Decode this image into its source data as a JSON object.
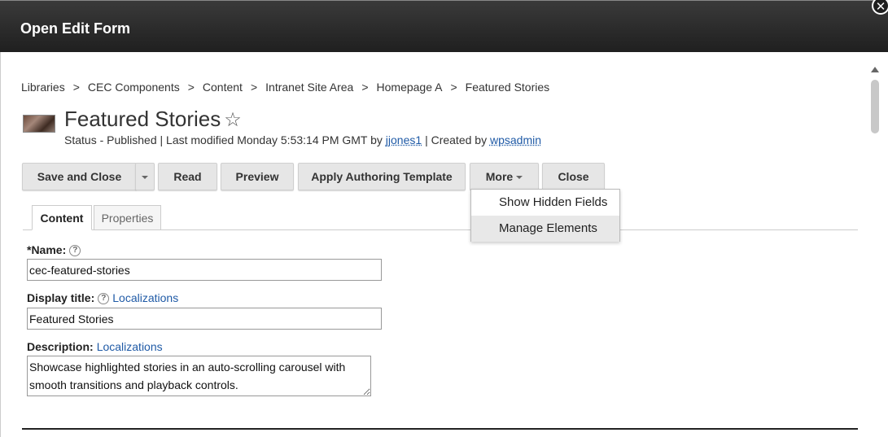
{
  "dialog": {
    "title": "Open Edit Form",
    "close_glyph": "✕"
  },
  "breadcrumb": [
    "Libraries",
    "CEC Components",
    "Content",
    "Intranet Site Area",
    "Homepage A",
    "Featured Stories"
  ],
  "breadcrumb_separator": ">",
  "item": {
    "title": "Featured Stories",
    "favorite_glyph": "☆",
    "status_prefix": "Status - Published | Last modified Monday 5:53:14 PM GMT by",
    "modified_by": "jjones1",
    "created_prefix": "| Created by",
    "created_by": "wpsadmin"
  },
  "toolbar": {
    "save_close": "Save and Close",
    "read": "Read",
    "preview": "Preview",
    "apply_template": "Apply Authoring Template",
    "more": "More",
    "close": "Close"
  },
  "more_menu": {
    "items": [
      "Show Hidden Fields",
      "Manage Elements"
    ],
    "hovered": "Manage Elements"
  },
  "tabs": [
    {
      "label": "Content",
      "active": true
    },
    {
      "label": "Properties",
      "active": false
    }
  ],
  "form": {
    "name_label": "*Name:",
    "name_value": "cec-featured-stories",
    "display_title_label": "Display title:",
    "display_title_link": "Localizations",
    "display_title_value": "Featured Stories",
    "description_label": "Description:",
    "description_link": "Localizations",
    "description_value": "Showcase highlighted stories in an auto-scrolling carousel with smooth transitions and playback controls."
  },
  "icons": {
    "help_glyph": "?"
  },
  "colors": {
    "titlebar": "#2a2a2a",
    "link": "#1f5aa6",
    "button_bg": "#e6e6e6"
  }
}
